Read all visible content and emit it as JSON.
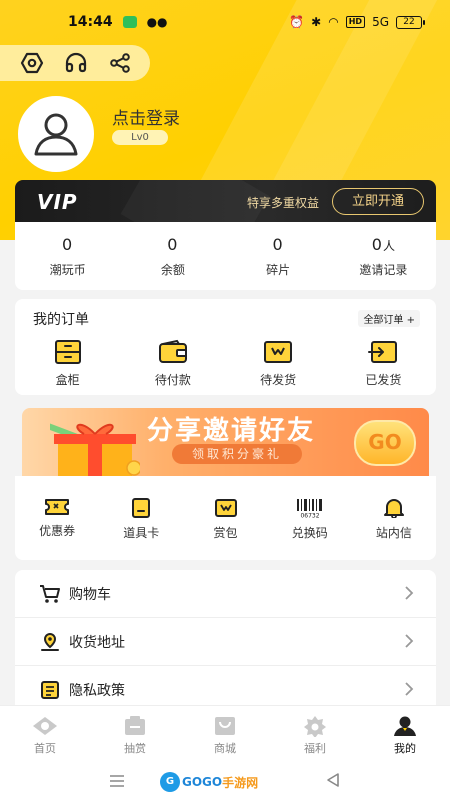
{
  "status_bar": {
    "time": "14:44",
    "signal": "5G",
    "battery": "22"
  },
  "profile": {
    "login_text": "点击登录",
    "level": "Lv0"
  },
  "vip": {
    "logo": "VIP",
    "slogan": "特享多重权益",
    "button": "立即开通"
  },
  "stats": [
    {
      "value": "0",
      "unit": "",
      "label": "潮玩币"
    },
    {
      "value": "0",
      "unit": "",
      "label": "余额"
    },
    {
      "value": "0",
      "unit": "",
      "label": "碎片"
    },
    {
      "value": "0",
      "unit": "人",
      "label": "邀请记录"
    }
  ],
  "orders": {
    "title": "我的订单",
    "all_label": "全部订单 +",
    "items": [
      {
        "label": "盒柜",
        "icon": "box-cabinet-icon"
      },
      {
        "label": "待付款",
        "icon": "wallet-icon"
      },
      {
        "label": "待发货",
        "icon": "package-icon"
      },
      {
        "label": "已发货",
        "icon": "shipped-icon"
      }
    ]
  },
  "banner": {
    "title": "分享邀请好友",
    "subtitle": "领取积分豪礼",
    "go": "GO"
  },
  "tools": [
    {
      "label": "优惠券",
      "icon": "coupon-icon"
    },
    {
      "label": "道具卡",
      "icon": "item-card-icon"
    },
    {
      "label": "赏包",
      "icon": "reward-bag-icon"
    },
    {
      "label": "兑换码",
      "icon": "barcode-icon",
      "code": "06732"
    },
    {
      "label": "站内信",
      "icon": "bell-icon"
    }
  ],
  "menu": [
    {
      "label": "购物车",
      "icon": "cart-icon"
    },
    {
      "label": "收货地址",
      "icon": "address-icon"
    },
    {
      "label": "隐私政策",
      "icon": "policy-icon"
    }
  ],
  "tabs": [
    {
      "label": "首页",
      "icon": "home-icon"
    },
    {
      "label": "抽赏",
      "icon": "draw-icon"
    },
    {
      "label": "商城",
      "icon": "shop-icon"
    },
    {
      "label": "福利",
      "icon": "benefit-icon"
    },
    {
      "label": "我的",
      "icon": "profile-icon",
      "active": true
    }
  ],
  "watermark": {
    "logo": "G",
    "text_a": "GOGO",
    "text_b": "手游网"
  },
  "colors": {
    "accent": "#FFD000",
    "vip_gold": "#E8C770",
    "banner_orange": "#FF8A49"
  }
}
